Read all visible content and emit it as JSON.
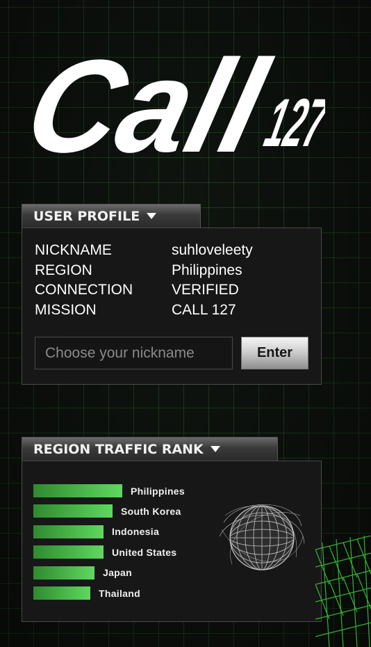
{
  "logo": {
    "main_text": "Call",
    "number_text": "127"
  },
  "profile": {
    "tab_title": "USER PROFILE",
    "rows": [
      {
        "key": "NICKNAME",
        "value": "suhloveleety"
      },
      {
        "key": "REGION",
        "value": "Philippines"
      },
      {
        "key": "CONNECTION",
        "value": "VERIFIED"
      },
      {
        "key": "MISSION",
        "value": "CALL 127"
      }
    ],
    "input": {
      "placeholder": "Choose your nickname",
      "value": ""
    },
    "enter_label": "Enter"
  },
  "ranking": {
    "tab_title": "REGION TRAFFIC RANK",
    "items": [
      {
        "label": "Philippines",
        "relative_value": 1.0
      },
      {
        "label": "South Korea",
        "relative_value": 0.89
      },
      {
        "label": "Indonesia",
        "relative_value": 0.79
      },
      {
        "label": "United States",
        "relative_value": 0.79
      },
      {
        "label": "Japan",
        "relative_value": 0.69
      },
      {
        "label": "Thailand",
        "relative_value": 0.64
      }
    ]
  },
  "colors": {
    "accent_green": "#5fd85f",
    "panel_bg": "#181818"
  },
  "icons": {
    "tab_caret": "caret-down-icon",
    "globe": "globe-icon"
  }
}
